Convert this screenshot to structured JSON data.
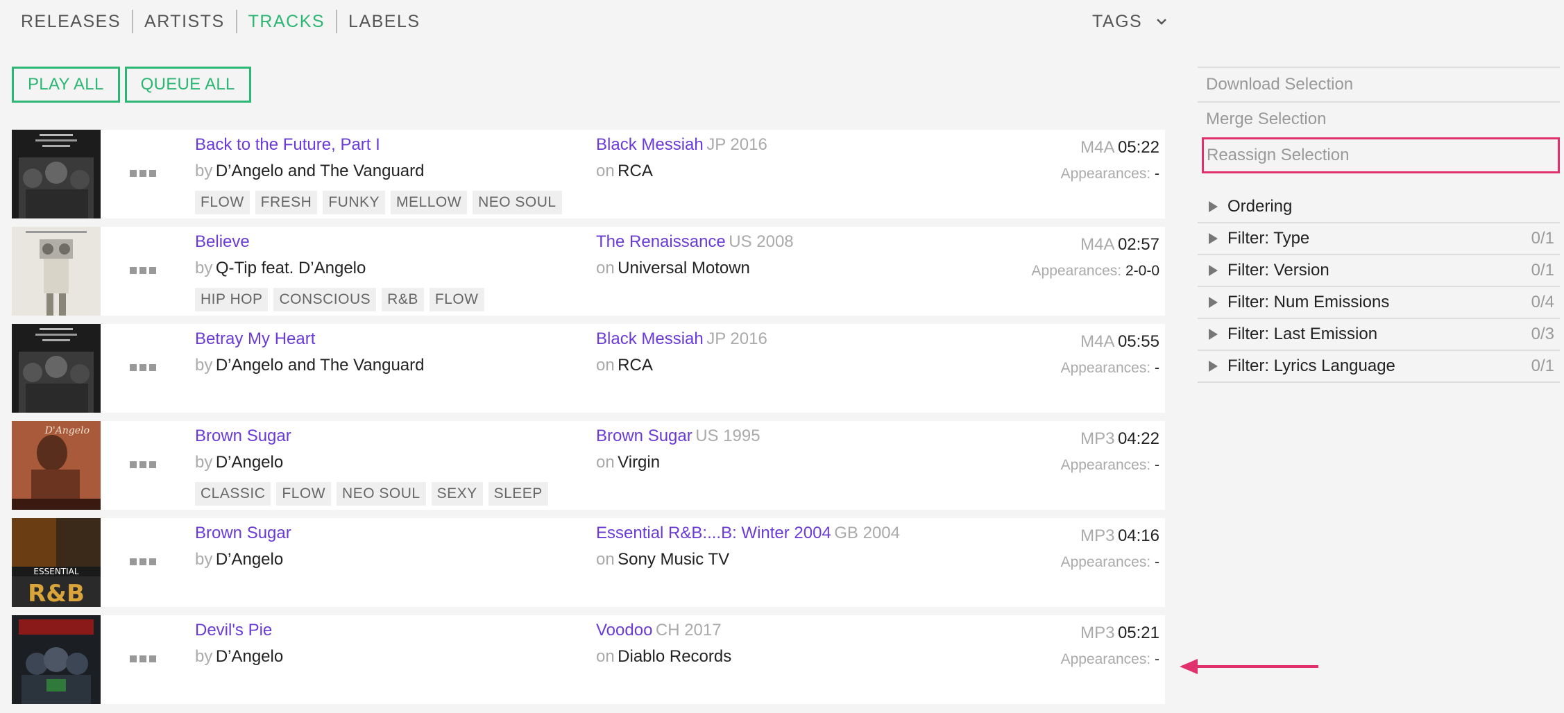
{
  "nav": {
    "items": [
      "RELEASES",
      "ARTISTS",
      "TRACKS",
      "LABELS"
    ],
    "tags_label": "TAGS"
  },
  "actions": {
    "play_all": "PLAY ALL",
    "queue_all": "QUEUE ALL"
  },
  "tracks": [
    {
      "title": "Back to the Future, Part I",
      "by": "by",
      "artist": "D’Angelo and The Vanguard",
      "album": "Black Messiah",
      "album_meta": "JP 2016",
      "on": "on",
      "label": "RCA",
      "format": "M4A",
      "duration": "05:22",
      "appearances_label": "Appearances:",
      "appearances": "-",
      "tags": [
        "FLOW",
        "FRESH",
        "FUNKY",
        "MELLOW",
        "NEO SOUL"
      ],
      "cover": "dark-bw"
    },
    {
      "title": "Believe",
      "by": "by",
      "artist": "Q-Tip feat. D’Angelo",
      "album": "The Renaissance",
      "album_meta": "US 2008",
      "on": "on",
      "label": "Universal Motown",
      "format": "M4A",
      "duration": "02:57",
      "appearances_label": "Appearances:",
      "appearances": "2-0-0",
      "tags": [
        "HIP HOP",
        "CONSCIOUS",
        "R&B",
        "FLOW"
      ],
      "cover": "light-boombox"
    },
    {
      "title": "Betray My Heart",
      "by": "by",
      "artist": "D’Angelo and The Vanguard",
      "album": "Black Messiah",
      "album_meta": "JP 2016",
      "on": "on",
      "label": "RCA",
      "format": "M4A",
      "duration": "05:55",
      "appearances_label": "Appearances:",
      "appearances": "-",
      "tags": [],
      "cover": "dark-bw"
    },
    {
      "title": "Brown Sugar",
      "by": "by",
      "artist": "D’Angelo",
      "album": "Brown Sugar",
      "album_meta": "US 1995",
      "on": "on",
      "label": "Virgin",
      "format": "MP3",
      "duration": "04:22",
      "appearances_label": "Appearances:",
      "appearances": "-",
      "tags": [
        "CLASSIC",
        "FLOW",
        "NEO SOUL",
        "SEXY",
        "SLEEP"
      ],
      "cover": "brown-portrait"
    },
    {
      "title": "Brown Sugar",
      "by": "by",
      "artist": "D’Angelo",
      "album": "Essential R&B:...B: Winter 2004",
      "album_meta": "GB 2004",
      "on": "on",
      "label": "Sony Music TV",
      "format": "MP3",
      "duration": "04:16",
      "appearances_label": "Appearances:",
      "appearances": "-",
      "tags": [],
      "cover": "essential-rnb"
    },
    {
      "title": "Devil's Pie",
      "by": "by",
      "artist": "D’Angelo",
      "album": "Voodoo",
      "album_meta": "CH 2017",
      "on": "on",
      "label": "Diablo Records",
      "format": "MP3",
      "duration": "05:21",
      "appearances_label": "Appearances:",
      "appearances": "-",
      "tags": [],
      "cover": "dark-red"
    }
  ],
  "selection": {
    "download": "Download Selection",
    "merge": "Merge Selection",
    "reassign": "Reassign Selection"
  },
  "facets": [
    {
      "label": "Ordering",
      "count": ""
    },
    {
      "label": "Filter: Type",
      "count": "0/1"
    },
    {
      "label": "Filter: Version",
      "count": "0/1"
    },
    {
      "label": "Filter: Num Emissions",
      "count": "0/4"
    },
    {
      "label": "Filter: Last Emission",
      "count": "0/3"
    },
    {
      "label": "Filter: Lyrics Language",
      "count": "0/1"
    }
  ],
  "colors": {
    "accent": "#2bb673",
    "link": "#6a3bd6",
    "highlight": "#e0306d"
  }
}
